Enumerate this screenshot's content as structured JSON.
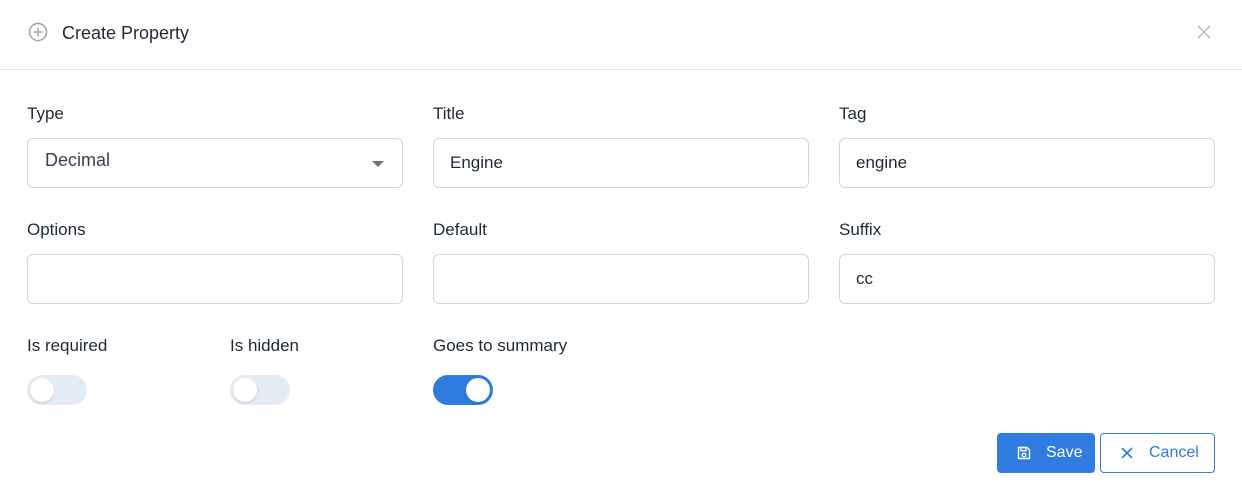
{
  "header": {
    "icon": "plus-circle-icon",
    "title": "Create Property",
    "close_icon": "close-icon"
  },
  "form": {
    "type": {
      "label": "Type",
      "value": "Decimal"
    },
    "title": {
      "label": "Title",
      "value": "Engine"
    },
    "tag": {
      "label": "Tag",
      "value": "engine"
    },
    "options": {
      "label": "Options",
      "value": ""
    },
    "default": {
      "label": "Default",
      "value": ""
    },
    "suffix": {
      "label": "Suffix",
      "value": "cc"
    },
    "is_required": {
      "label": "Is required",
      "checked": false
    },
    "is_hidden": {
      "label": "Is hidden",
      "checked": false
    },
    "goes_to_summary": {
      "label": "Goes to summary",
      "checked": true
    }
  },
  "footer": {
    "save": {
      "label": "Save",
      "icon": "save-icon"
    },
    "cancel": {
      "label": "Cancel",
      "icon": "x-icon"
    }
  },
  "colors": {
    "accent": "#2f7be0",
    "toggle_off": "#e5ebf5",
    "border": "#d1d5db",
    "icon_gray": "#9ca3af"
  }
}
